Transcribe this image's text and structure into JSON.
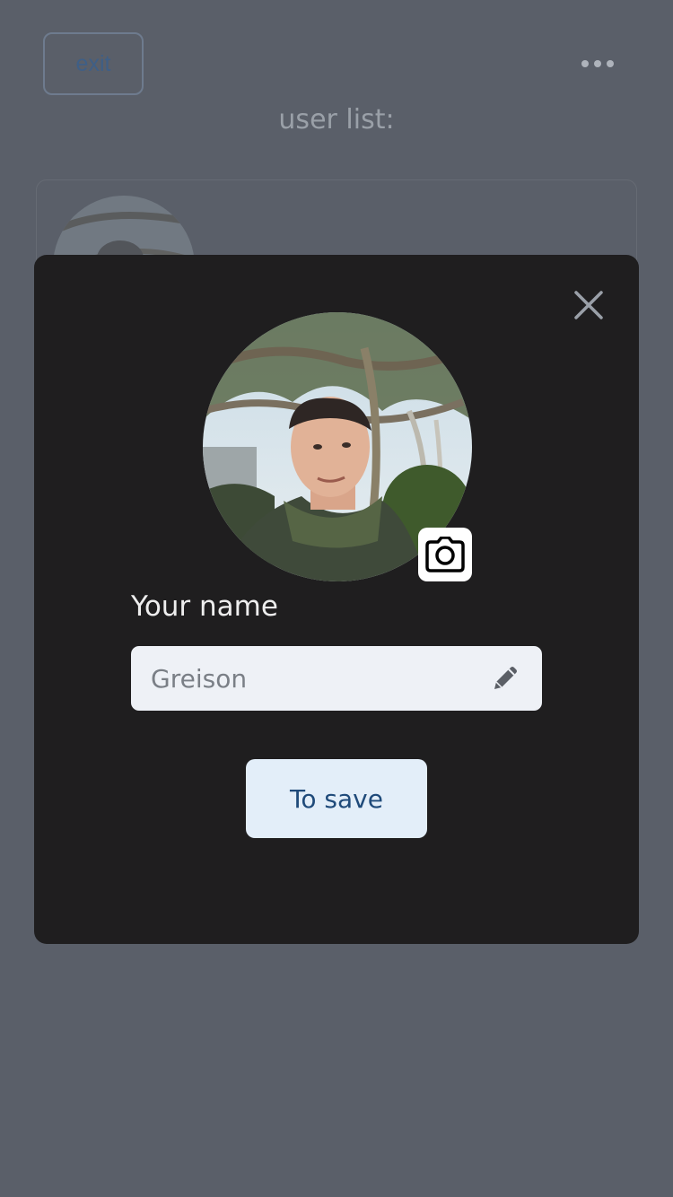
{
  "background": {
    "exit_label": "exit",
    "more_icon": "more-horizontal-icon",
    "list_title": "user list:"
  },
  "modal": {
    "close_icon": "close-icon",
    "camera_icon": "camera-icon",
    "name_label": "Your name",
    "name_value": "Greison",
    "edit_icon": "pencil-icon",
    "save_label": "To save"
  },
  "colors": {
    "overlay_bg": "#5a5f69",
    "modal_bg": "#1f1e1f",
    "input_bg": "#eef1f6",
    "button_bg": "#e3eef9",
    "button_text": "#1f4a7a"
  }
}
